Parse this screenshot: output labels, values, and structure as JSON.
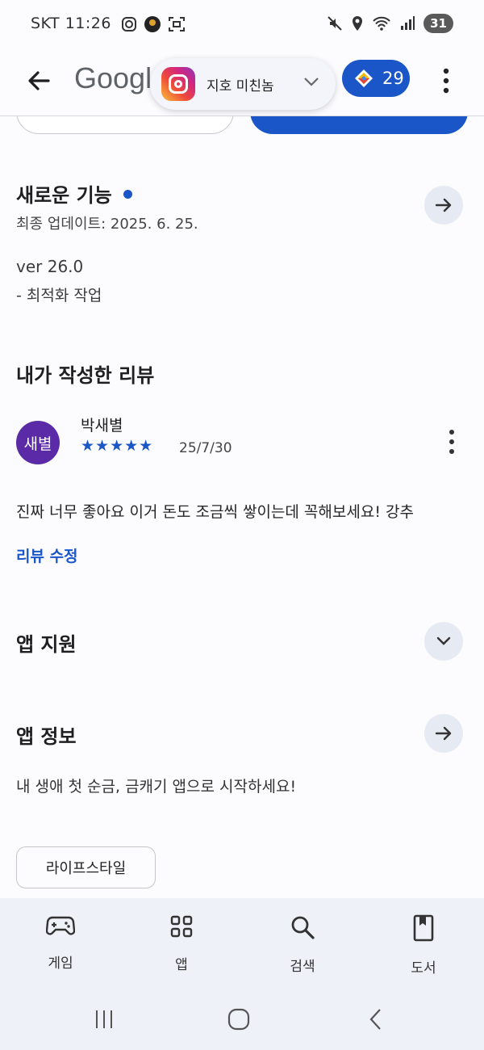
{
  "status_bar": {
    "carrier_time": "SKT 11:26",
    "battery": "31"
  },
  "app_bar": {
    "logo_text": "Googl",
    "notification_label": "지호 미친놈",
    "points": "29"
  },
  "whats_new": {
    "title": "새로운 기능",
    "updated": "최종 업데이트: 2025. 6. 25.",
    "version": "ver 26.0",
    "note": "- 최적화 작업"
  },
  "my_review": {
    "title": "내가 작성한 리뷰",
    "avatar_text": "새별",
    "reviewer": "박새별",
    "stars": "★★★★★",
    "rating": 5,
    "date": "25/7/30",
    "body": "진짜 너무 좋아요 이거 돈도 조금씩 쌓이는데 꼭해보세요! 강추",
    "edit_link": "리뷰 수정"
  },
  "app_support": {
    "title": "앱 지원"
  },
  "app_info": {
    "title": "앱 정보",
    "description": "내 생애 첫 순금, 금캐기 앱으로 시작하세요!",
    "category_chip": "라이프스타일"
  },
  "bottom_nav": {
    "items": [
      {
        "label": "게임",
        "icon": "gamepad-icon"
      },
      {
        "label": "앱",
        "icon": "apps-grid-icon"
      },
      {
        "label": "검색",
        "icon": "search-icon"
      },
      {
        "label": "도서",
        "icon": "book-icon"
      }
    ]
  },
  "colors": {
    "accent": "#1a56c8",
    "avatar": "#5b2aa6",
    "nav_background": "#eef1f7"
  }
}
